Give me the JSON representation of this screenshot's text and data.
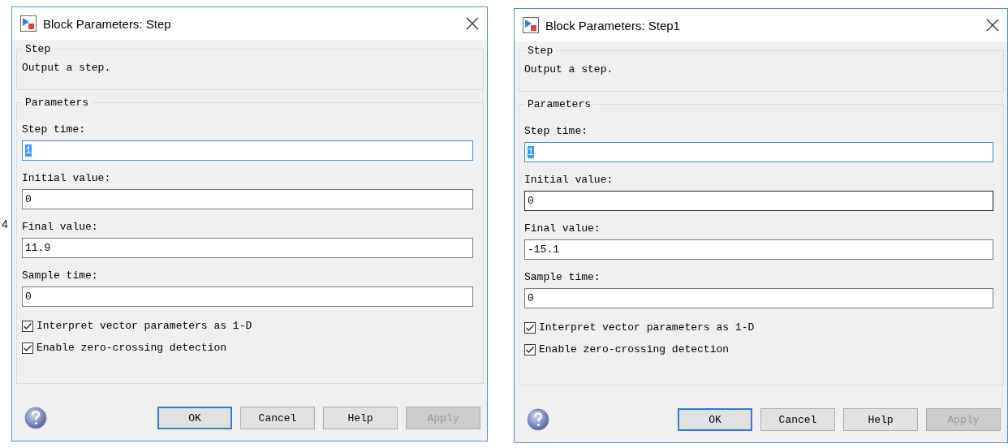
{
  "canvas": {
    "labels": [
      "4"
    ]
  },
  "dialogs": [
    {
      "title": "Block Parameters: Step",
      "block_group": {
        "legend": "Step",
        "description": "Output a step."
      },
      "parameters_group": {
        "legend": "Parameters",
        "fields": [
          {
            "label": "Step time:",
            "value": "1",
            "focused": true,
            "hovered": false
          },
          {
            "label": "Initial value:",
            "value": "0",
            "focused": false,
            "hovered": false
          },
          {
            "label": "Final value:",
            "value": "11.9",
            "focused": false,
            "hovered": false
          },
          {
            "label": "Sample time:",
            "value": "0",
            "focused": false,
            "hovered": false
          }
        ],
        "checkboxes": [
          {
            "label": "Interpret vector parameters as 1-D",
            "checked": true
          },
          {
            "label": "Enable zero-crossing detection",
            "checked": true
          }
        ]
      },
      "buttons": [
        {
          "label": "OK",
          "default": true,
          "disabled": false
        },
        {
          "label": "Cancel",
          "default": false,
          "disabled": false
        },
        {
          "label": "Help",
          "default": false,
          "disabled": false
        },
        {
          "label": "Apply",
          "default": false,
          "disabled": true
        }
      ]
    },
    {
      "title": "Block Parameters: Step1",
      "block_group": {
        "legend": "Step",
        "description": "Output a step."
      },
      "parameters_group": {
        "legend": "Parameters",
        "fields": [
          {
            "label": "Step time:",
            "value": "1",
            "focused": true,
            "hovered": false
          },
          {
            "label": "Initial value:",
            "value": "0",
            "focused": false,
            "hovered": true
          },
          {
            "label": "Final value:",
            "value": "-15.1",
            "focused": false,
            "hovered": false
          },
          {
            "label": "Sample time:",
            "value": "0",
            "focused": false,
            "hovered": false
          }
        ],
        "checkboxes": [
          {
            "label": "Interpret vector parameters as 1-D",
            "checked": true
          },
          {
            "label": "Enable zero-crossing detection",
            "checked": true
          }
        ]
      },
      "buttons": [
        {
          "label": "OK",
          "default": true,
          "disabled": false
        },
        {
          "label": "Cancel",
          "default": false,
          "disabled": false
        },
        {
          "label": "Help",
          "default": false,
          "disabled": false
        },
        {
          "label": "Apply",
          "default": false,
          "disabled": true
        }
      ]
    }
  ]
}
